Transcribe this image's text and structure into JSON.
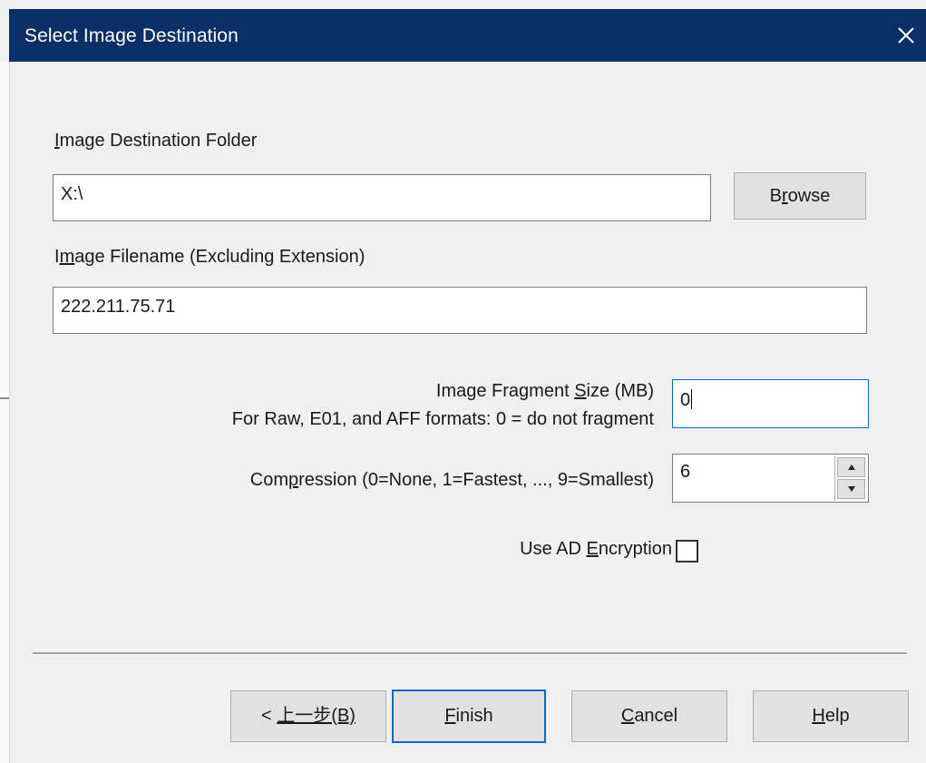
{
  "window": {
    "title": "Select Image Destination",
    "close_icon": "close-icon"
  },
  "destination_folder": {
    "label_prefix": "",
    "label_mnemonic": "I",
    "label_rest": "mage Destination Folder",
    "value": "X:\\",
    "browse_prefix": "B",
    "browse_mnemonic": "r",
    "browse_rest": "owse"
  },
  "filename": {
    "label_prefix": "I",
    "label_mnemonic": "m",
    "label_rest": "age Filename (Excluding Extension)",
    "value": "222.211.75.71"
  },
  "fragment": {
    "label_prefix": "Image Fragment ",
    "label_mnemonic": "S",
    "label_rest": "ize (MB)",
    "note": "For Raw, E01, and AFF formats: 0 = do not fragment",
    "value": "0"
  },
  "compression": {
    "label_prefix": "Com",
    "label_mnemonic": "p",
    "label_rest": "ression (0=None, 1=Fastest, ..., 9=Smallest)",
    "value": "6"
  },
  "encryption": {
    "label_prefix": "Use AD ",
    "label_mnemonic": "E",
    "label_rest": "ncryption",
    "checked": false
  },
  "buttons": {
    "back_prefix": "< ",
    "back_mnemonic_text": "上一步(B)",
    "finish_mnemonic": "F",
    "finish_rest": "inish",
    "cancel_mnemonic": "C",
    "cancel_rest": "ancel",
    "help_mnemonic": "H",
    "help_rest": "elp"
  },
  "colors": {
    "titlebar": "#0a2f66",
    "dialog_bg": "#f0f0f0",
    "focus_border": "#0a66c8"
  }
}
